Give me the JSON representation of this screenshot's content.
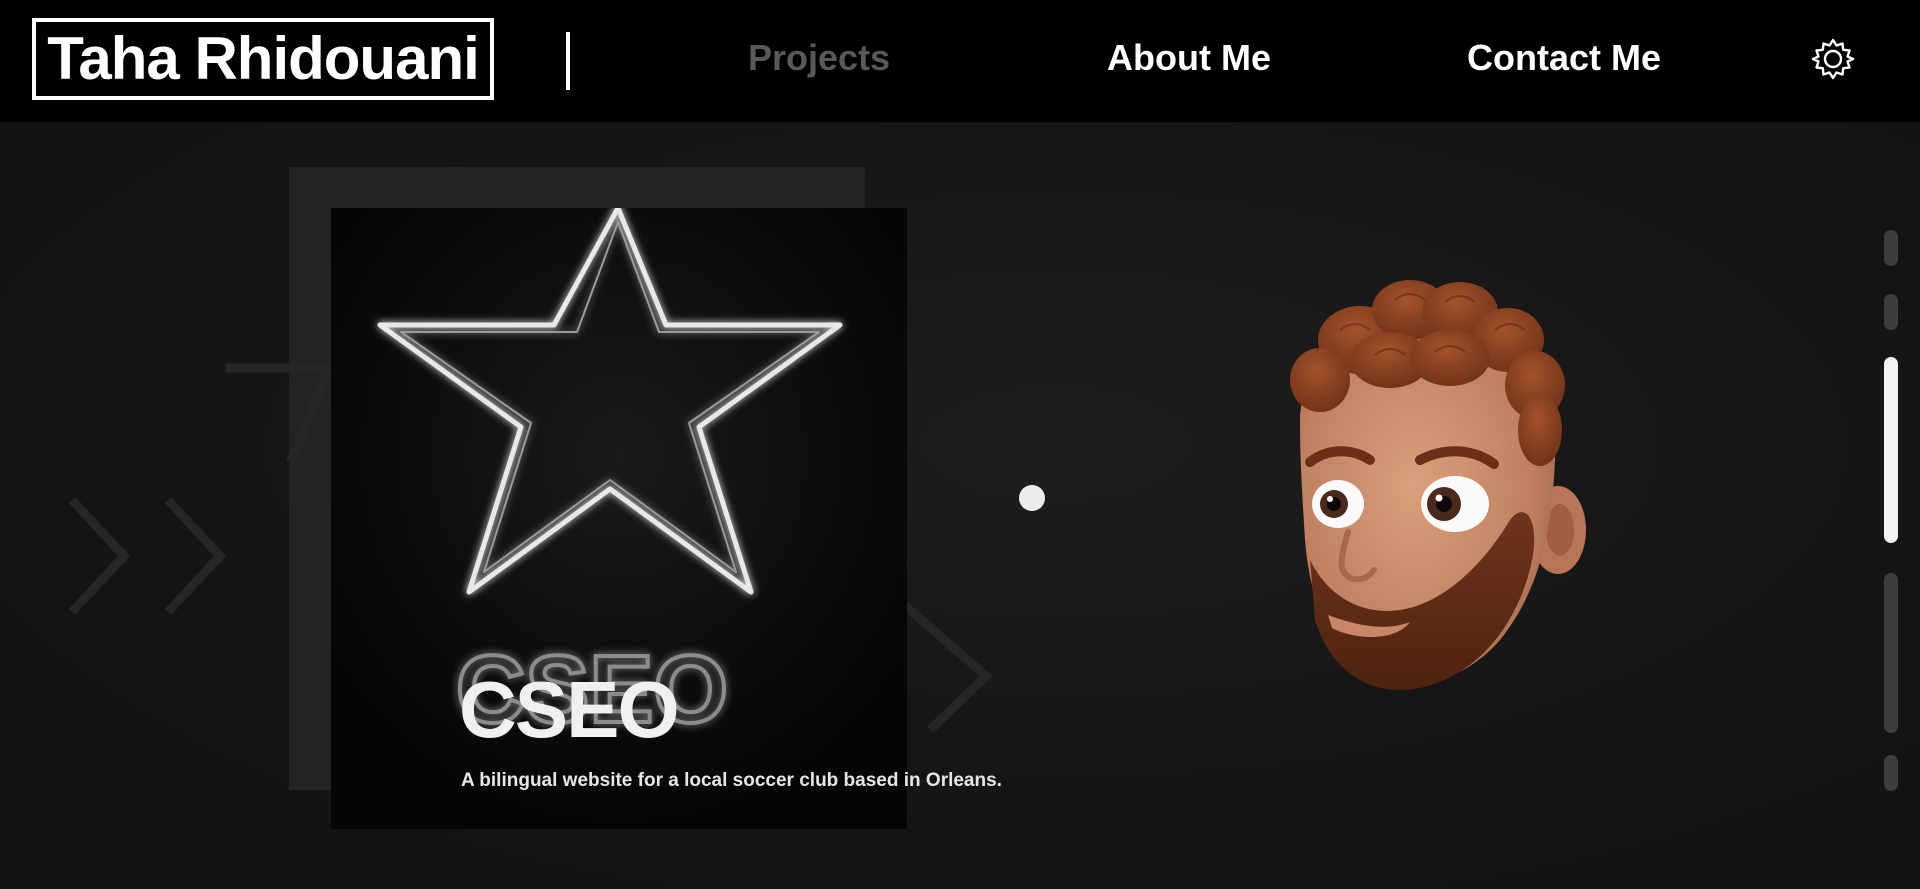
{
  "header": {
    "logo_text": "Taha Rhidouani",
    "nav": [
      {
        "label": "Projects",
        "active": true
      },
      {
        "label": "About Me",
        "active": false
      },
      {
        "label": "Contact Me",
        "active": false
      }
    ],
    "settings_icon": "gear-icon"
  },
  "project": {
    "title": "CSEO",
    "description": "A bilingual website for a local soccer club based in Orleans.",
    "art_text": "CSEO",
    "art_icon": "neon-star"
  },
  "pager": {
    "sections": 5,
    "active_index": 2
  },
  "colors": {
    "background": "#131313",
    "nav_background": "#000000",
    "text": "#ffffff",
    "inactive_nav": "#595959"
  }
}
